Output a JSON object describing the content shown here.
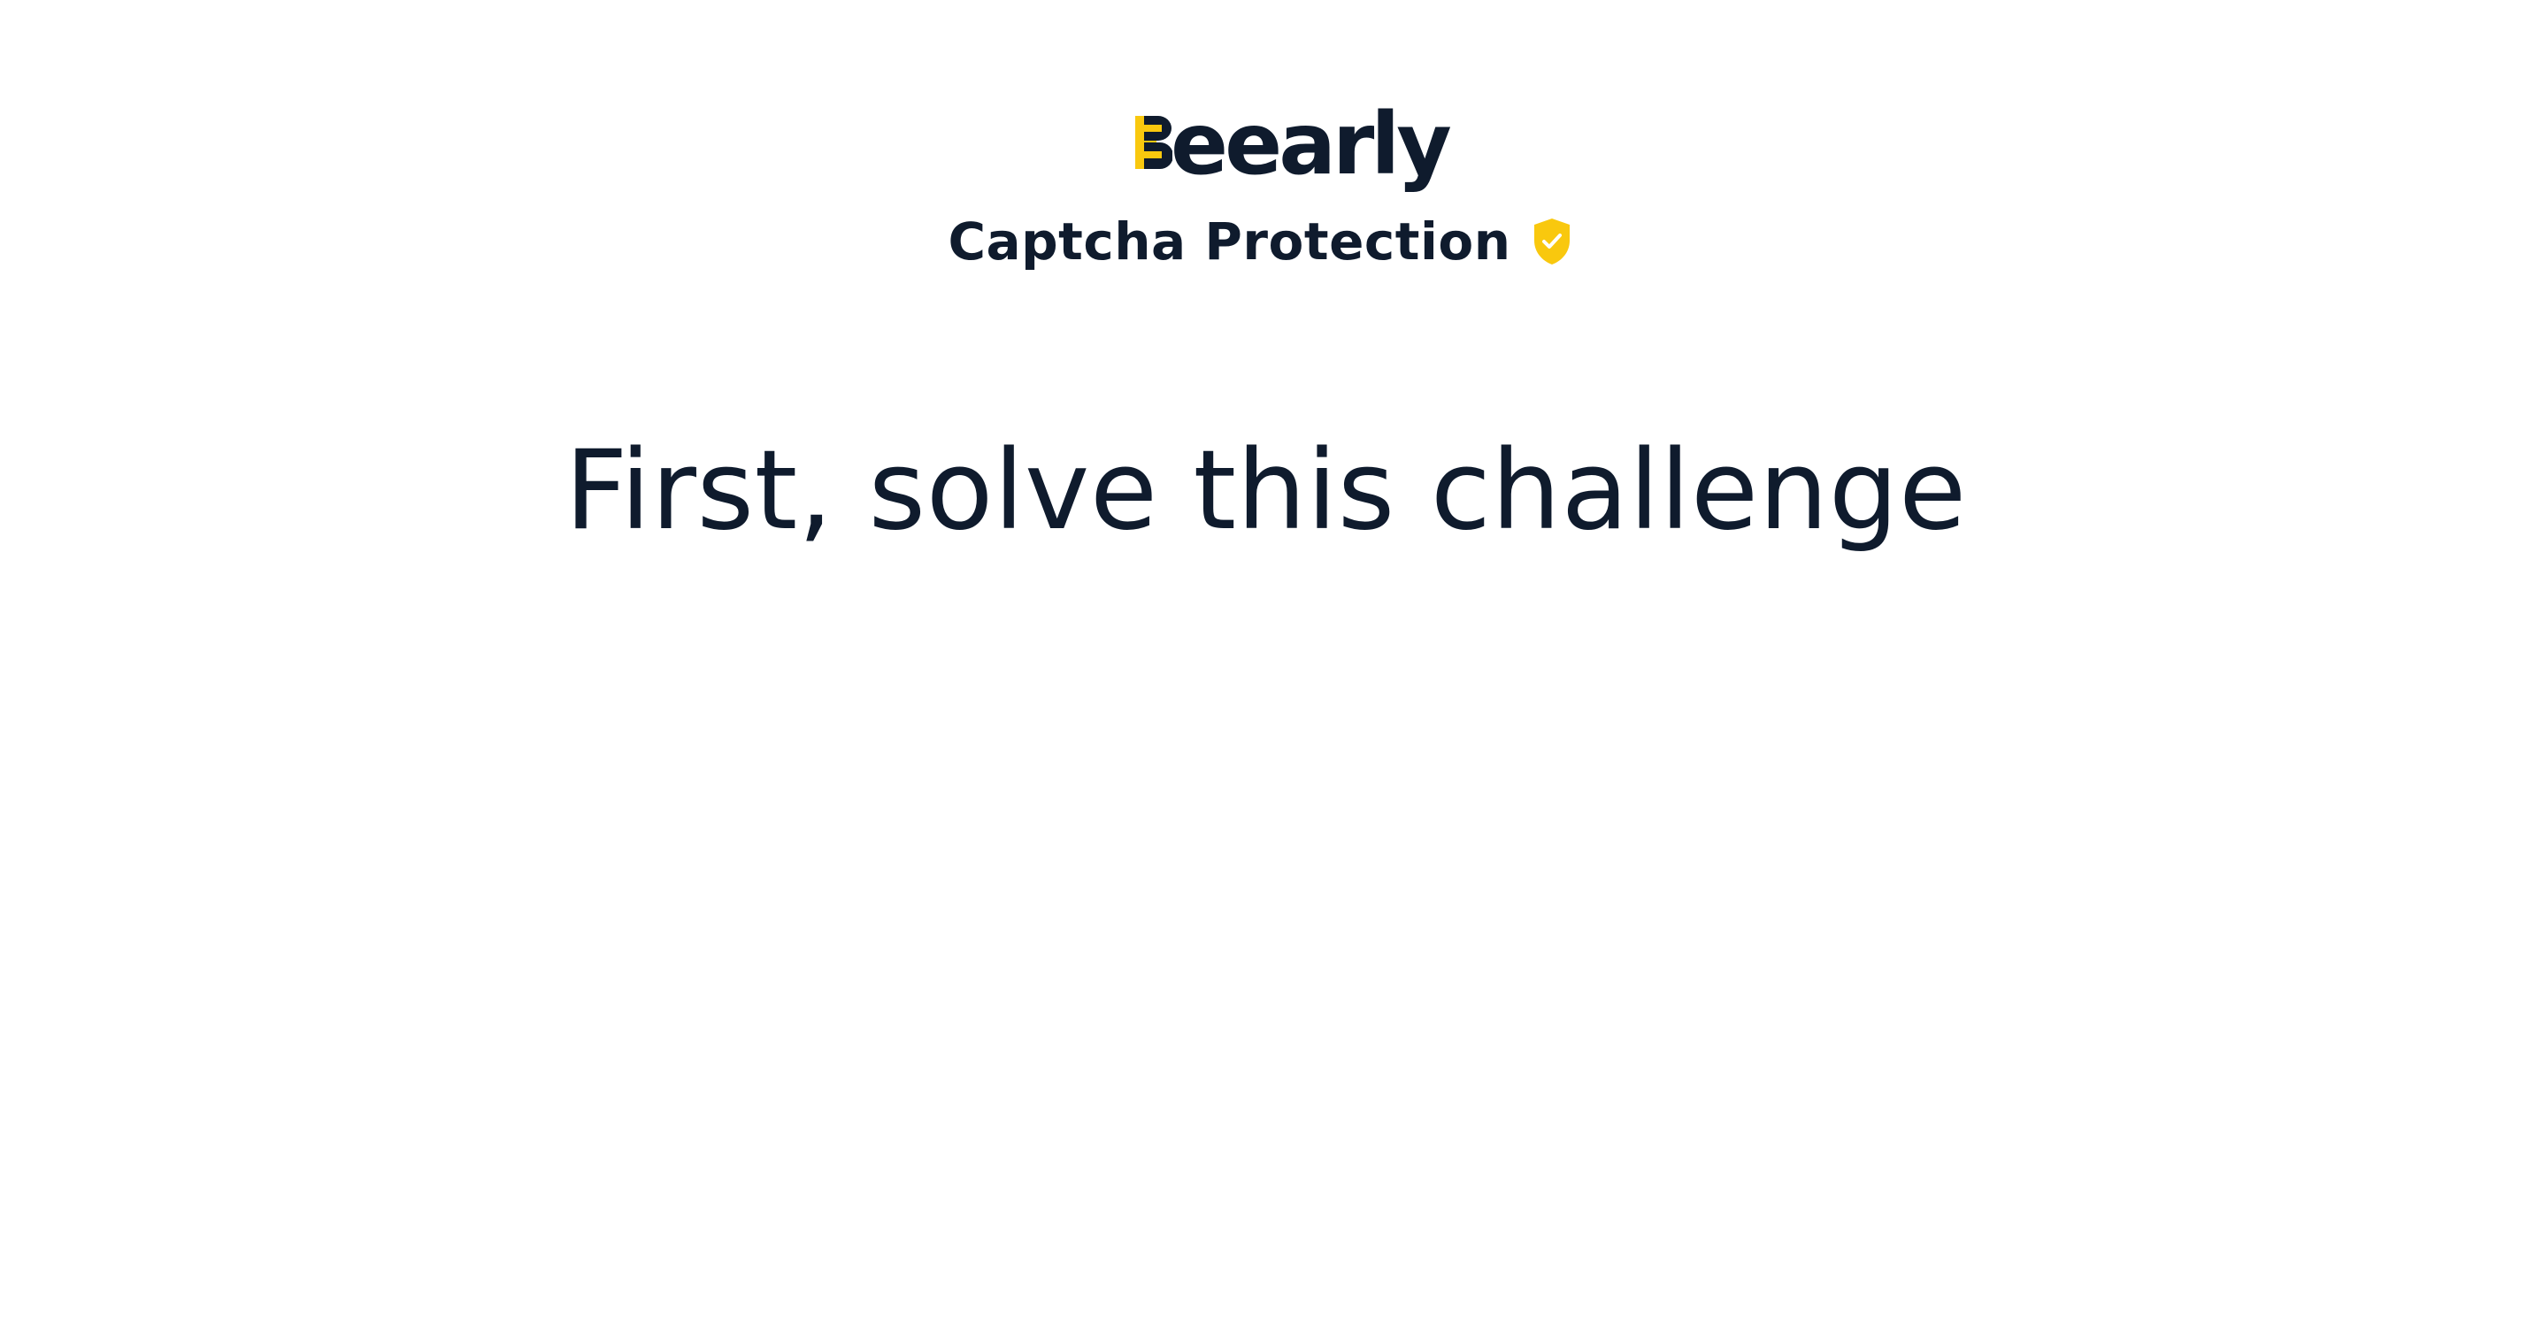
{
  "brand": {
    "name": "Beearly",
    "logo_text": "eearly",
    "accent_color": "#f9c80e",
    "text_color": "#0f1b2d"
  },
  "header": {
    "subtitle": "Captcha Protection",
    "badge_icon": "shield-check-icon"
  },
  "main": {
    "title": "First, solve this challenge"
  }
}
